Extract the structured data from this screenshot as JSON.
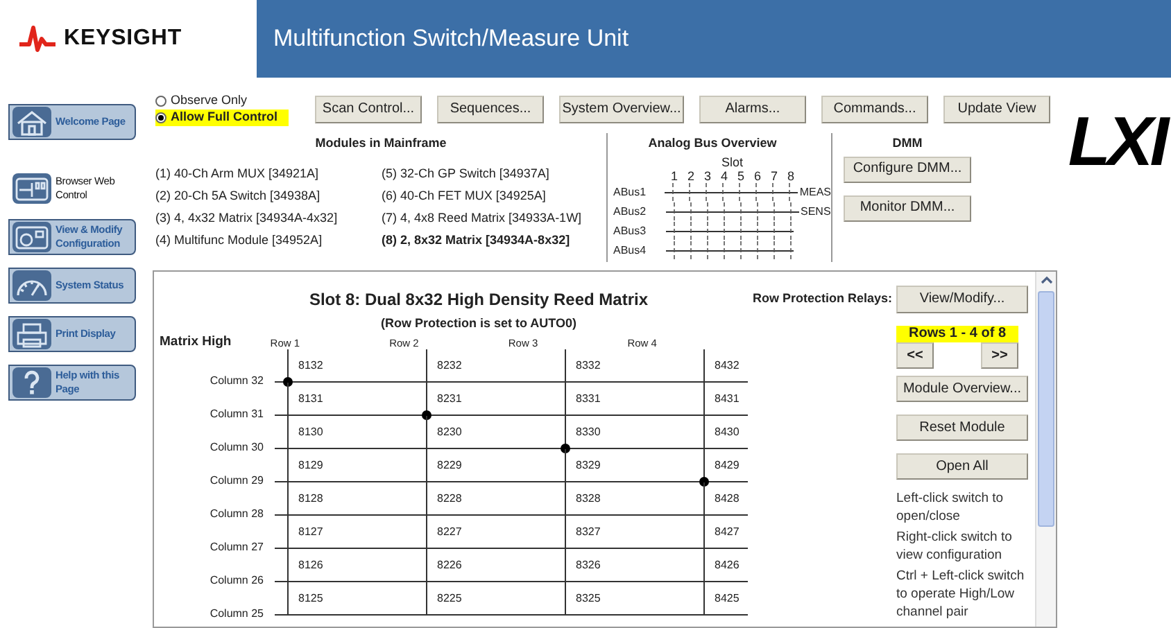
{
  "header": {
    "brand": "KEYSIGHT",
    "title": "Multifunction Switch/Measure Unit"
  },
  "nav": [
    {
      "label": "Welcome Page",
      "kind": "home",
      "selected": false
    },
    {
      "label": "Browser Web Control",
      "kind": "browser",
      "selected": true
    },
    {
      "label": "View & Modify Configuration",
      "kind": "config",
      "selected": false
    },
    {
      "label": "System Status",
      "kind": "gauge",
      "selected": false
    },
    {
      "label": "Print Display",
      "kind": "printer",
      "selected": false
    },
    {
      "label": "Help with this Page",
      "kind": "help",
      "selected": false
    }
  ],
  "access_mode": [
    {
      "label": "Observe Only",
      "selected": false
    },
    {
      "label": "Allow Full Control",
      "selected": true
    }
  ],
  "toolbar": [
    "Scan Control...",
    "Sequences...",
    "System Overview...",
    "Alarms...",
    "Commands...",
    "Update View"
  ],
  "modules": {
    "title": "Modules in Mainframe",
    "items": [
      {
        "label": "(1) 40-Ch Arm MUX [34921A]",
        "selected": false
      },
      {
        "label": "(2) 20-Ch 5A Switch [34938A]",
        "selected": false
      },
      {
        "label": "(3) 4, 4x32 Matrix [34934A-4x32]",
        "selected": false
      },
      {
        "label": "(4) Multifunc Module [34952A]",
        "selected": false
      },
      {
        "label": "(5) 32-Ch GP Switch [34937A]",
        "selected": false
      },
      {
        "label": "(6) 40-Ch FET MUX [34925A]",
        "selected": false
      },
      {
        "label": "(7) 4, 4x8 Reed Matrix [34933A-1W]",
        "selected": false
      },
      {
        "label": "(8) 2, 8x32 Matrix [34934A-8x32]",
        "selected": true
      }
    ]
  },
  "analog_bus": {
    "title": "Analog Bus Overview",
    "slot_label": "Slot",
    "slots": [
      "1",
      "2",
      "3",
      "4",
      "5",
      "6",
      "7",
      "8"
    ],
    "buses": [
      {
        "label": "ABus1",
        "end": "MEAS"
      },
      {
        "label": "ABus2",
        "end": "SENS"
      },
      {
        "label": "ABus3"
      },
      {
        "label": "ABus4"
      }
    ]
  },
  "dmm": {
    "title": "DMM",
    "buttons": [
      "Configure DMM...",
      "Monitor DMM..."
    ]
  },
  "logo": "LXI",
  "matrix": {
    "title": "Slot 8: Dual 8x32 High Density Reed Matrix",
    "subtitle": "(Row Protection is set to AUTO0)",
    "side_label": "Matrix High",
    "rows": [
      "Row 1",
      "Row 2",
      "Row 3",
      "Row 4"
    ],
    "columns": [
      {
        "label": "Column 32",
        "cells": [
          {
            "label": "8132",
            "closed": true
          },
          {
            "label": "8232",
            "closed": false
          },
          {
            "label": "8332",
            "closed": false
          },
          {
            "label": "8432",
            "closed": false
          }
        ]
      },
      {
        "label": "Column 31",
        "cells": [
          {
            "label": "8131",
            "closed": false
          },
          {
            "label": "8231",
            "closed": true
          },
          {
            "label": "8331",
            "closed": false
          },
          {
            "label": "8431",
            "closed": false
          }
        ]
      },
      {
        "label": "Column 30",
        "cells": [
          {
            "label": "8130",
            "closed": false
          },
          {
            "label": "8230",
            "closed": false
          },
          {
            "label": "8330",
            "closed": true
          },
          {
            "label": "8430",
            "closed": false
          }
        ]
      },
      {
        "label": "Column 29",
        "cells": [
          {
            "label": "8129",
            "closed": false
          },
          {
            "label": "8229",
            "closed": false
          },
          {
            "label": "8329",
            "closed": false
          },
          {
            "label": "8429",
            "closed": true
          }
        ]
      },
      {
        "label": "Column 28",
        "cells": [
          {
            "label": "8128",
            "closed": false
          },
          {
            "label": "8228",
            "closed": false
          },
          {
            "label": "8328",
            "closed": false
          },
          {
            "label": "8428",
            "closed": false
          }
        ]
      },
      {
        "label": "Column 27",
        "cells": [
          {
            "label": "8127",
            "closed": false
          },
          {
            "label": "8227",
            "closed": false
          },
          {
            "label": "8327",
            "closed": false
          },
          {
            "label": "8427",
            "closed": false
          }
        ]
      },
      {
        "label": "Column 26",
        "cells": [
          {
            "label": "8126",
            "closed": false
          },
          {
            "label": "8226",
            "closed": false
          },
          {
            "label": "8326",
            "closed": false
          },
          {
            "label": "8426",
            "closed": false
          }
        ]
      },
      {
        "label": "Column 25",
        "cells": [
          {
            "label": "8125",
            "closed": false
          },
          {
            "label": "8225",
            "closed": false
          },
          {
            "label": "8325",
            "closed": false
          },
          {
            "label": "8425",
            "closed": false
          }
        ]
      }
    ]
  },
  "actions": {
    "protection_label": "Row Protection Relays:",
    "protection_button": "View/Modify...",
    "page_range": "Rows 1 - 4 of 8",
    "prev": "<<",
    "next": ">>",
    "buttons": [
      "Module Overview...",
      "Reset Module",
      "Open All"
    ],
    "help": [
      "Left-click switch to open/close",
      "Right-click switch to view configuration",
      "Ctrl + Left-click switch to operate High/Low channel pair"
    ]
  }
}
